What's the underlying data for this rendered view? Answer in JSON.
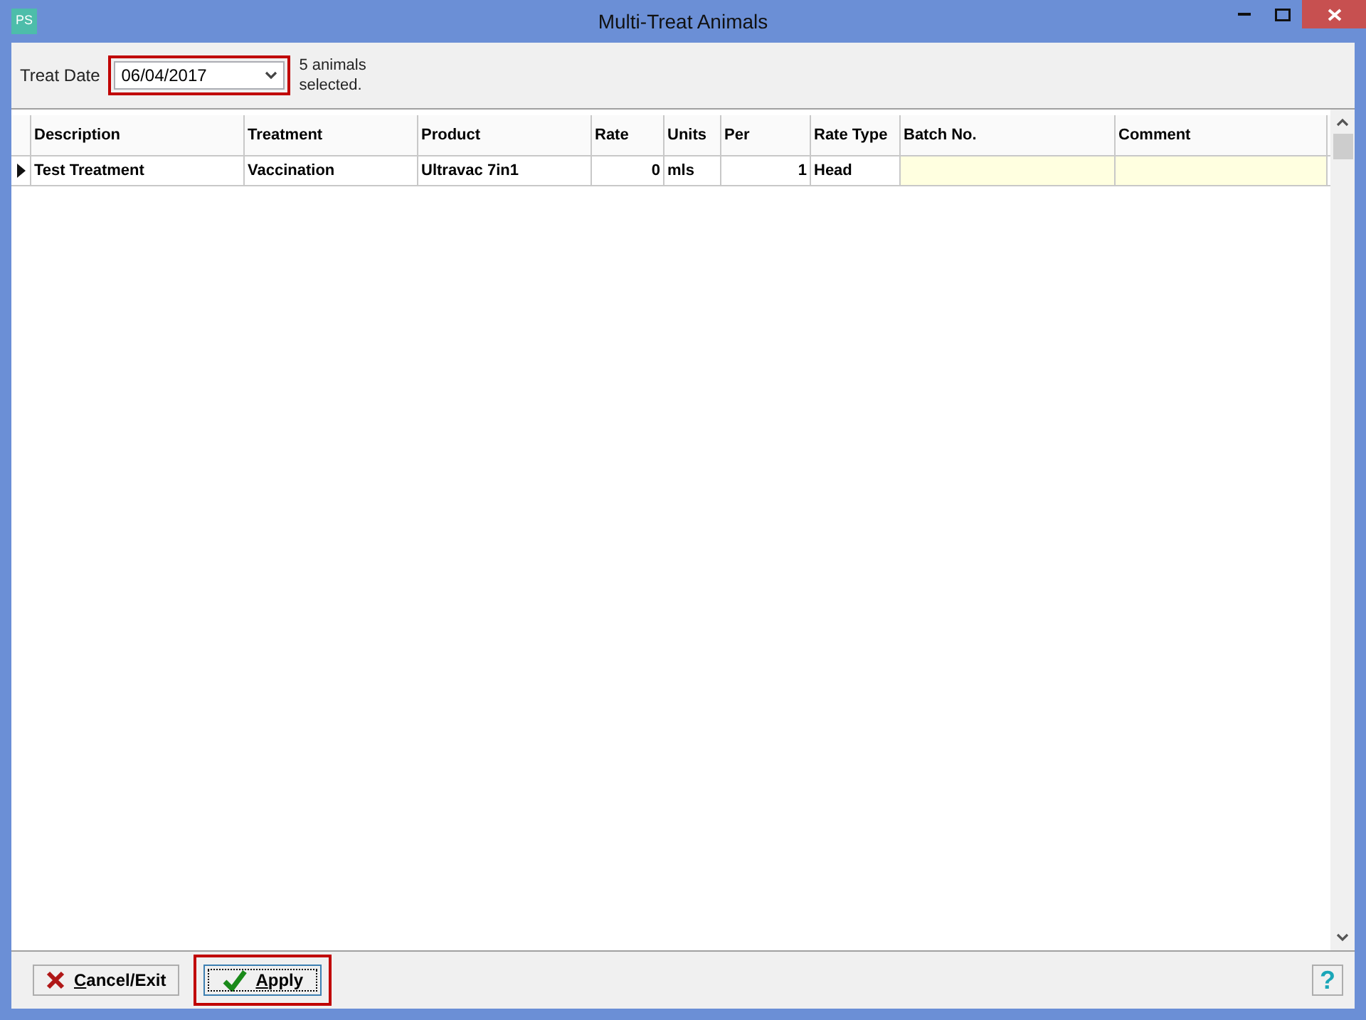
{
  "window": {
    "title": "Multi-Treat Animals",
    "app_icon": "PS"
  },
  "treat_date": {
    "label": "Treat Date",
    "value": "06/04/2017",
    "highlighted": true
  },
  "selection_note": "5 animals selected.",
  "table": {
    "columns": [
      {
        "label": "Description",
        "kind": "text",
        "editable": false
      },
      {
        "label": "Treatment",
        "kind": "text",
        "editable": false
      },
      {
        "label": "Product",
        "kind": "text",
        "editable": false
      },
      {
        "label": "Rate",
        "kind": "number",
        "editable": false
      },
      {
        "label": "Units",
        "kind": "text",
        "editable": false
      },
      {
        "label": "Per",
        "kind": "number",
        "editable": false
      },
      {
        "label": "Rate Type",
        "kind": "text",
        "editable": false
      },
      {
        "label": "Batch No.",
        "kind": "text",
        "editable": true
      },
      {
        "label": "Comment",
        "kind": "text",
        "editable": true
      }
    ],
    "rows": [
      {
        "current": true,
        "cells": [
          "Test Treatment",
          "Vaccination",
          "Ultravac 7in1",
          "0",
          "mls",
          "1",
          "Head",
          "",
          ""
        ]
      }
    ]
  },
  "buttons": [
    {
      "kind": "cancel",
      "label": "Cancel/Exit",
      "highlighted": false
    },
    {
      "kind": "apply",
      "label": "Apply",
      "highlighted": true
    }
  ],
  "help": {
    "label": "?"
  }
}
